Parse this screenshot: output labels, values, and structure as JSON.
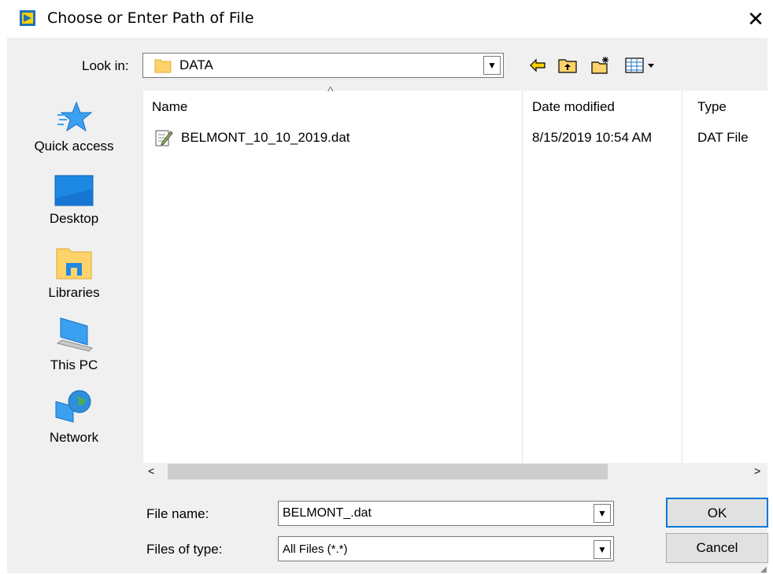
{
  "window": {
    "title": "Choose or Enter Path of File",
    "close_glyph": "✕",
    "icon": "labview-app-icon"
  },
  "lookin": {
    "label": "Look in:",
    "value": "DATA",
    "dropdown_glyph": "▼"
  },
  "places": [
    {
      "label": "Quick access",
      "icon": "star-icon"
    },
    {
      "label": "Desktop",
      "icon": "desktop-icon"
    },
    {
      "label": "Libraries",
      "icon": "libraries-icon"
    },
    {
      "label": "This PC",
      "icon": "computer-icon"
    },
    {
      "label": "Network",
      "icon": "network-icon"
    }
  ],
  "filelist": {
    "columns": [
      "Name",
      "Date modified",
      "Type"
    ],
    "sort_caret": "^",
    "rows": [
      {
        "name": "BELMONT_10_10_2019.dat",
        "date": "8/15/2019 10:54 AM",
        "type": "DAT File"
      }
    ]
  },
  "scroll": {
    "left": "<",
    "right": ">"
  },
  "filename": {
    "label": "File name:",
    "value": "BELMONT_.dat"
  },
  "filetype": {
    "label": "Files of type:",
    "value": "All Files (*.*)"
  },
  "buttons": {
    "ok": "OK",
    "cancel": "Cancel"
  },
  "colors": {
    "accent": "#0078d7",
    "panel": "#f0f0f0",
    "folder": "#ffd36b"
  }
}
